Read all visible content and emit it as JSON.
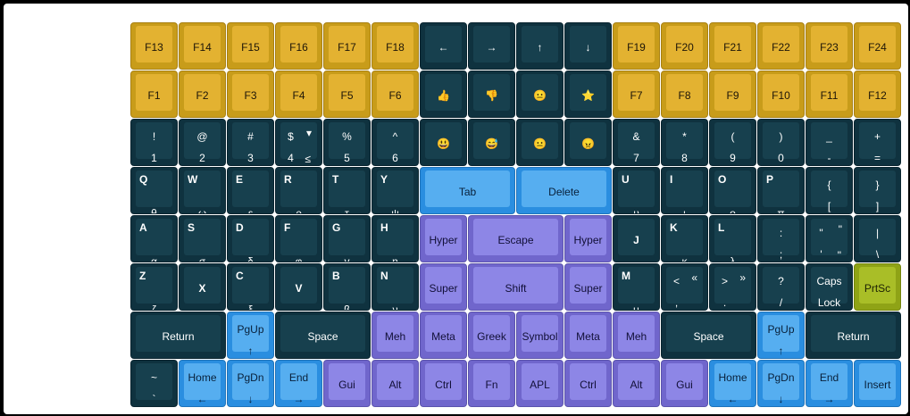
{
  "layout": {
    "columns": 16,
    "rows": [
      [
        {
          "main": "F13",
          "color": "gold"
        },
        {
          "main": "F14",
          "color": "gold"
        },
        {
          "main": "F15",
          "color": "gold"
        },
        {
          "main": "F16",
          "color": "gold"
        },
        {
          "main": "F17",
          "color": "gold"
        },
        {
          "main": "F18",
          "color": "gold"
        },
        {
          "main": "←",
          "color": "dark"
        },
        {
          "main": "→",
          "color": "dark"
        },
        {
          "main": "↑",
          "color": "dark"
        },
        {
          "main": "↓",
          "color": "dark"
        },
        {
          "main": "F19",
          "color": "gold"
        },
        {
          "main": "F20",
          "color": "gold"
        },
        {
          "main": "F21",
          "color": "gold"
        },
        {
          "main": "F22",
          "color": "gold"
        },
        {
          "main": "F23",
          "color": "gold"
        },
        {
          "main": "F24",
          "color": "gold"
        }
      ],
      [
        {
          "main": "F1",
          "color": "gold"
        },
        {
          "main": "F2",
          "color": "gold"
        },
        {
          "main": "F3",
          "color": "gold"
        },
        {
          "main": "F4",
          "color": "gold"
        },
        {
          "main": "F5",
          "color": "gold"
        },
        {
          "main": "F6",
          "color": "gold"
        },
        {
          "main": "👍",
          "color": "dark"
        },
        {
          "main": "👎",
          "color": "dark"
        },
        {
          "main": "😐",
          "color": "dark"
        },
        {
          "main": "⭐",
          "color": "dark"
        },
        {
          "main": "F7",
          "color": "gold"
        },
        {
          "main": "F8",
          "color": "gold"
        },
        {
          "main": "F9",
          "color": "gold"
        },
        {
          "main": "F10",
          "color": "gold"
        },
        {
          "main": "F11",
          "color": "gold"
        },
        {
          "main": "F12",
          "color": "gold"
        }
      ],
      [
        {
          "top": "!",
          "bottom": "1",
          "color": "dark"
        },
        {
          "top": "@",
          "bottom": "2",
          "color": "dark"
        },
        {
          "top": "#",
          "bottom": "3",
          "color": "dark"
        },
        {
          "top": "$",
          "bottom": "4",
          "alt_top": "▾",
          "alt_bottom": "≤",
          "color": "dark"
        },
        {
          "top": "%",
          "bottom": "5",
          "color": "dark"
        },
        {
          "top": "^",
          "bottom": "6",
          "color": "dark"
        },
        {
          "main": "😃",
          "color": "dark"
        },
        {
          "main": "😅",
          "color": "dark"
        },
        {
          "main": "😐",
          "color": "dark"
        },
        {
          "main": "😠",
          "color": "dark"
        },
        {
          "top": "&",
          "bottom": "7",
          "color": "dark"
        },
        {
          "top": "*",
          "bottom": "8",
          "color": "dark"
        },
        {
          "top": "(",
          "bottom": "9",
          "color": "dark"
        },
        {
          "top": ")",
          "bottom": "0",
          "color": "dark"
        },
        {
          "top": "_",
          "bottom": "-",
          "color": "dark"
        },
        {
          "top": "+",
          "bottom": "=",
          "color": "dark"
        }
      ],
      [
        {
          "corner": "Q",
          "greek": "θ",
          "color": "dark"
        },
        {
          "corner": "W",
          "greek": "ω",
          "color": "dark"
        },
        {
          "corner": "E",
          "greek": "ε",
          "color": "dark"
        },
        {
          "corner": "R",
          "greek": "ρ",
          "color": "dark"
        },
        {
          "corner": "T",
          "greek": "τ",
          "color": "dark"
        },
        {
          "corner": "Y",
          "greek": "ψ",
          "color": "dark"
        },
        {
          "main": "Tab",
          "color": "blue",
          "w": 2
        },
        {
          "main": "Delete",
          "color": "blue",
          "w": 2
        },
        {
          "corner": "U",
          "greek": "υ",
          "color": "dark"
        },
        {
          "corner": "I",
          "greek": "ι",
          "color": "dark"
        },
        {
          "corner": "O",
          "greek": "ο",
          "color": "dark"
        },
        {
          "corner": "P",
          "greek": "π",
          "color": "dark"
        },
        {
          "top": "{",
          "bottom": "[",
          "color": "dark"
        },
        {
          "top": "}",
          "bottom": "]",
          "color": "dark"
        }
      ],
      [
        {
          "corner": "A",
          "greek": "α",
          "color": "dark"
        },
        {
          "corner": "S",
          "greek": "σ",
          "color": "dark"
        },
        {
          "corner": "D",
          "greek": "δ",
          "color": "dark"
        },
        {
          "corner": "F",
          "greek": "φ",
          "color": "dark"
        },
        {
          "corner": "G",
          "greek": "γ",
          "color": "dark"
        },
        {
          "corner": "H",
          "greek": "η",
          "color": "dark"
        },
        {
          "main": "Hyper",
          "color": "purple"
        },
        {
          "main": "Escape",
          "color": "purple",
          "w": 2
        },
        {
          "main": "Hyper",
          "color": "purple"
        },
        {
          "main": "J",
          "color": "dark",
          "bold": true
        },
        {
          "corner": "K",
          "greek": "κ",
          "color": "dark"
        },
        {
          "corner": "L",
          "greek": "λ",
          "color": "dark"
        },
        {
          "top": ":",
          "bottom": ";",
          "color": "dark"
        },
        {
          "top": "\"",
          "bottom": "'",
          "alt_top": "\"",
          "alt_bottom": "\"",
          "color": "dark"
        },
        {
          "top": "|",
          "bottom": "\\",
          "color": "dark"
        }
      ],
      [
        {
          "corner": "Z",
          "greek": "ζ",
          "color": "dark"
        },
        {
          "main": "X",
          "color": "dark",
          "bold": true
        },
        {
          "corner": "C",
          "greek": "ξ",
          "color": "dark"
        },
        {
          "main": "V",
          "color": "dark",
          "bold": true
        },
        {
          "corner": "B",
          "greek": "β",
          "color": "dark"
        },
        {
          "corner": "N",
          "greek": "ν",
          "color": "dark"
        },
        {
          "main": "Super",
          "color": "purple"
        },
        {
          "main": "Shift",
          "color": "purple",
          "w": 2
        },
        {
          "main": "Super",
          "color": "purple"
        },
        {
          "corner": "M",
          "greek": "μ",
          "color": "dark"
        },
        {
          "top": "<",
          "bottom": ",",
          "alt_top": "«",
          "color": "dark"
        },
        {
          "top": ">",
          "bottom": ".",
          "alt_top": "»",
          "color": "dark"
        },
        {
          "top": "?",
          "bottom": "/",
          "color": "dark"
        },
        {
          "top": "Caps",
          "bottom": "Lock",
          "color": "dark"
        },
        {
          "main": "PrtSc",
          "color": "olive"
        }
      ],
      [
        {
          "main": "Return",
          "color": "dark",
          "w": 2
        },
        {
          "top": "PgUp",
          "bottom": "↑",
          "color": "blue"
        },
        {
          "main": "Space",
          "color": "dark",
          "w": 2
        },
        {
          "main": "Meh",
          "color": "purple"
        },
        {
          "main": "Meta",
          "color": "purple"
        },
        {
          "main": "Greek",
          "color": "purple"
        },
        {
          "main": "Symbol",
          "color": "purple"
        },
        {
          "main": "Meta",
          "color": "purple"
        },
        {
          "main": "Meh",
          "color": "purple"
        },
        {
          "main": "Space",
          "color": "dark",
          "w": 2
        },
        {
          "top": "PgUp",
          "bottom": "↑",
          "color": "blue"
        },
        {
          "main": "Return",
          "color": "dark",
          "w": 2
        }
      ],
      [
        {
          "top": "~",
          "bottom": "`",
          "color": "dark"
        },
        {
          "top": "Home",
          "bottom": "←",
          "color": "blue"
        },
        {
          "top": "PgDn",
          "bottom": "↓",
          "color": "blue"
        },
        {
          "top": "End",
          "bottom": "→",
          "color": "blue"
        },
        {
          "main": "Gui",
          "color": "purple"
        },
        {
          "main": "Alt",
          "color": "purple"
        },
        {
          "main": "Ctrl",
          "color": "purple"
        },
        {
          "main": "Fn",
          "color": "purple"
        },
        {
          "main": "APL",
          "color": "purple"
        },
        {
          "main": "Ctrl",
          "color": "purple"
        },
        {
          "main": "Alt",
          "color": "purple"
        },
        {
          "main": "Gui",
          "color": "purple"
        },
        {
          "top": "Home",
          "bottom": "←",
          "color": "blue"
        },
        {
          "top": "PgDn",
          "bottom": "↓",
          "color": "blue"
        },
        {
          "top": "End",
          "bottom": "→",
          "color": "blue"
        },
        {
          "main": "Insert",
          "color": "blue"
        }
      ]
    ]
  }
}
